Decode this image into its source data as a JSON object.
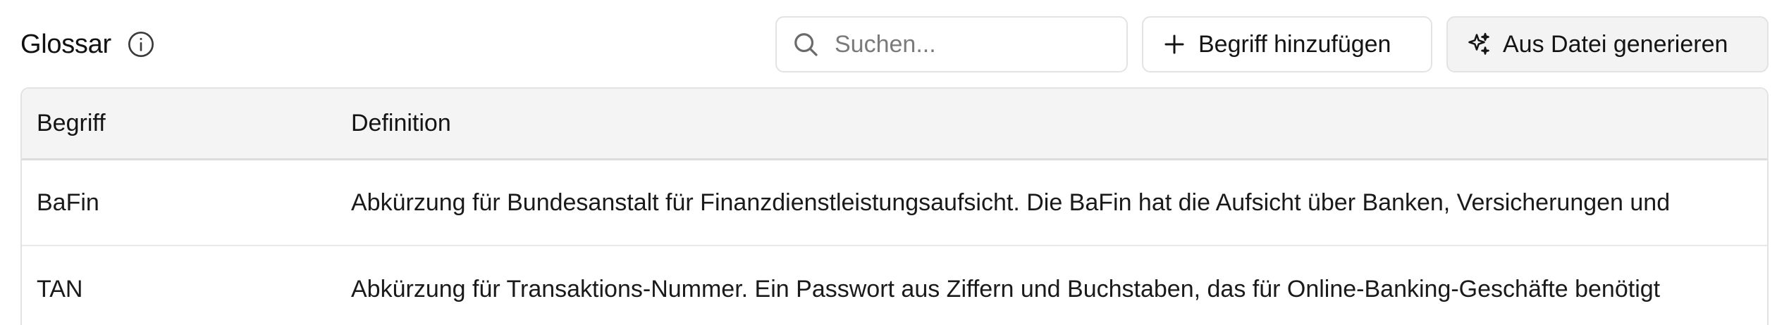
{
  "header": {
    "title": "Glossar",
    "search_placeholder": "Suchen...",
    "add_label": "Begriff hinzufügen",
    "generate_label": "Aus Datei generieren"
  },
  "table": {
    "columns": [
      "Begriff",
      "Definition"
    ],
    "rows": [
      {
        "term": "BaFin",
        "definition": "Abkürzung für Bundesanstalt für Finanzdienstleistungsaufsicht. Die BaFin hat die Aufsicht über Banken, Versicherungen und"
      },
      {
        "term": "TAN",
        "definition": "Abkürzung für Transaktions-Nummer. Ein Passwort aus Ziffern und Buchstaben, das für Online-Banking-Geschäfte benötigt"
      }
    ]
  },
  "icons": {
    "info": "info-icon",
    "search": "search-icon",
    "plus": "plus-icon",
    "sparkles": "sparkles-icon"
  }
}
